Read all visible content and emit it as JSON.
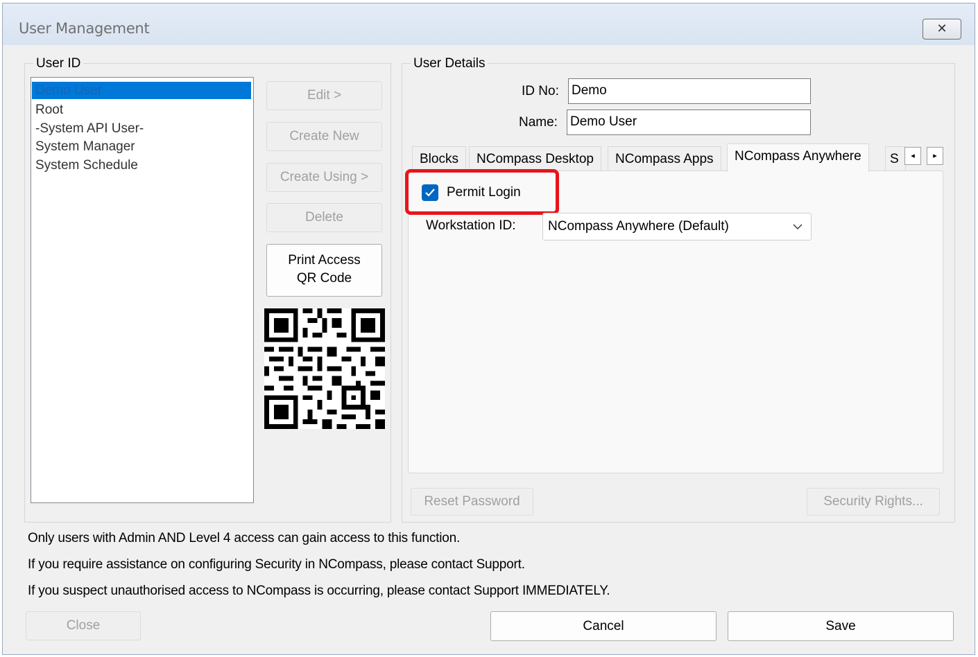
{
  "window": {
    "title": "User Management",
    "close_glyph": "✕"
  },
  "user_id_group": {
    "legend": "User ID",
    "users": [
      "Demo User",
      "Root",
      "-System API User-",
      "System Manager",
      "System Schedule"
    ],
    "selected_index": 0
  },
  "actions": {
    "edit": "Edit >",
    "create_new": "Create New",
    "create_using": "Create Using >",
    "delete": "Delete",
    "print_qr_line1": "Print Access",
    "print_qr_line2": "QR Code"
  },
  "user_details": {
    "legend": "User Details",
    "id_label": "ID No:",
    "id_value": "Demo",
    "name_label": "Name:",
    "name_value": "Demo User"
  },
  "tabs": {
    "items": [
      "Blocks",
      "NCompass Desktop",
      "NCompass Apps",
      "NCompass Anywhere",
      "S"
    ],
    "active": "NCompass Anywhere",
    "scroll_left": "◂",
    "scroll_right": "▸"
  },
  "anywhere_panel": {
    "permit_login_label": "Permit Login",
    "permit_login_checked": true,
    "workstation_label": "Workstation ID:",
    "workstation_value": "NCompass Anywhere (Default)"
  },
  "detail_buttons": {
    "reset_password": "Reset Password",
    "security_rights": "Security Rights..."
  },
  "info": {
    "line1": "Only users with Admin AND Level 4 access can gain access to this function.",
    "line2": "If you require assistance on configuring Security in NCompass, please contact Support.",
    "line3": "If you suspect unauthorised access to NCompass is occurring, please contact Support IMMEDIATELY."
  },
  "footer": {
    "close": "Close",
    "cancel": "Cancel",
    "save": "Save"
  },
  "colors": {
    "selection": "#0078d7",
    "checkbox": "#0067c0",
    "highlight_box": "#e8141b"
  }
}
